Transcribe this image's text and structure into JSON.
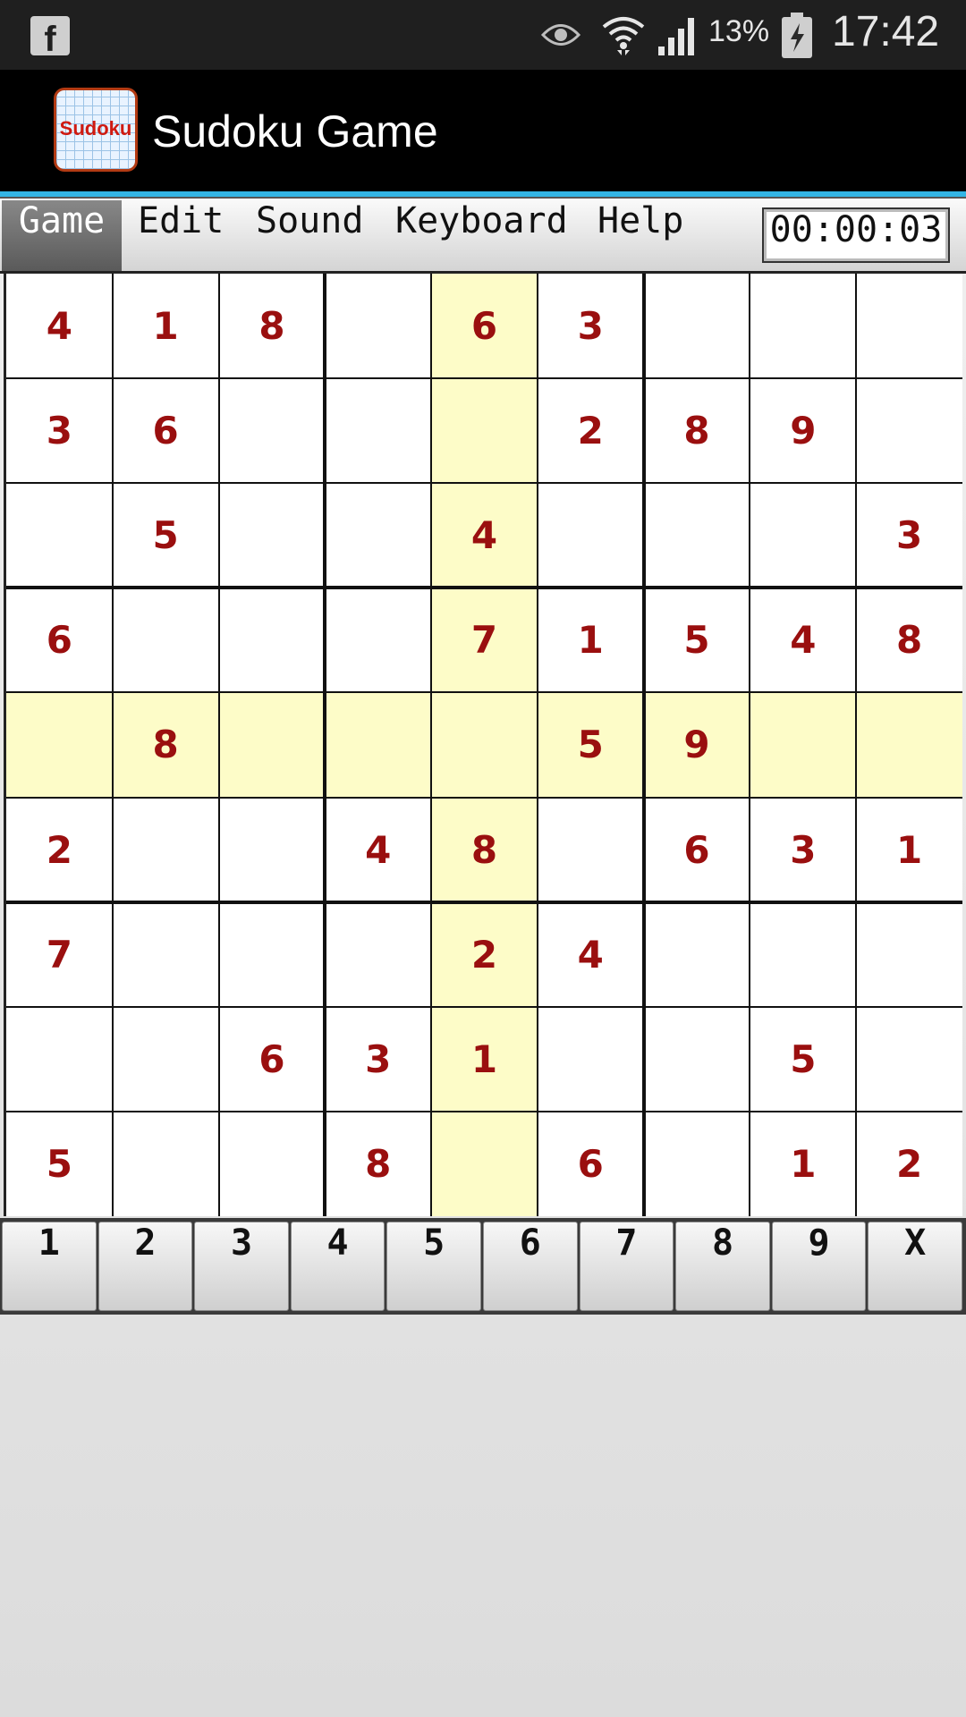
{
  "status_bar": {
    "battery_percent": "13%",
    "time": "17:42",
    "icons": [
      "facebook-icon",
      "eye-icon",
      "wifi-icon",
      "signal-icon",
      "battery-icon"
    ]
  },
  "app_bar": {
    "title": "Sudoku Game",
    "icon_word": "Sudoku"
  },
  "menu": {
    "items": [
      "Game",
      "Edit",
      "Sound",
      "Keyboard",
      "Help"
    ],
    "selected": "Game",
    "timer": "00:00:03"
  },
  "colors": {
    "accent": "#33b5e5",
    "digit": "#9a0f0f",
    "highlight": "#fdfcc8"
  },
  "board": {
    "grid": [
      [
        4,
        1,
        8,
        0,
        6,
        3,
        0,
        0,
        0
      ],
      [
        3,
        6,
        0,
        0,
        0,
        2,
        8,
        9,
        0
      ],
      [
        0,
        5,
        0,
        0,
        4,
        0,
        0,
        0,
        3
      ],
      [
        6,
        0,
        0,
        0,
        7,
        1,
        5,
        4,
        8
      ],
      [
        0,
        8,
        0,
        0,
        0,
        5,
        9,
        0,
        0
      ],
      [
        2,
        0,
        0,
        4,
        8,
        0,
        6,
        3,
        1
      ],
      [
        7,
        0,
        0,
        0,
        2,
        4,
        0,
        0,
        0
      ],
      [
        0,
        0,
        6,
        3,
        1,
        0,
        0,
        5,
        0
      ],
      [
        5,
        0,
        0,
        8,
        0,
        6,
        0,
        1,
        2
      ]
    ],
    "highlight_row": 5,
    "highlight_col": 5
  },
  "keypad": {
    "keys": [
      "1",
      "2",
      "3",
      "4",
      "5",
      "6",
      "7",
      "8",
      "9",
      "X"
    ]
  }
}
